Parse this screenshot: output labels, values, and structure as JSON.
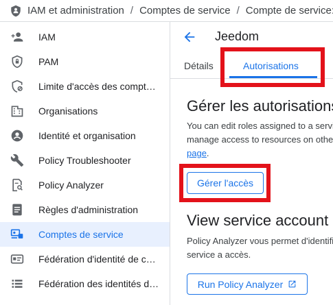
{
  "breadcrumb": {
    "items": [
      "IAM et administration",
      "Comptes de service",
      "Compte de service:"
    ],
    "separator": "/"
  },
  "sidebar": {
    "items": [
      {
        "label": "IAM",
        "icon": "person-add-icon"
      },
      {
        "label": "PAM",
        "icon": "shield-lock-icon"
      },
      {
        "label": "Limite d'accès des comptes principaux",
        "icon": "shield-boundary-icon"
      },
      {
        "label": "Organisations",
        "icon": "building-icon"
      },
      {
        "label": "Identité et organisation",
        "icon": "account-circle-icon"
      },
      {
        "label": "Policy Troubleshooter",
        "icon": "wrench-icon"
      },
      {
        "label": "Policy Analyzer",
        "icon": "document-search-icon"
      },
      {
        "label": "Règles d'administration",
        "icon": "document-list-icon"
      },
      {
        "label": "Comptes de service",
        "icon": "service-account-icon",
        "active": true
      },
      {
        "label": "Fédération d'identité de charge de travail",
        "icon": "id-card-icon"
      },
      {
        "label": "Fédération des identités de personnel",
        "icon": "list-icon"
      }
    ]
  },
  "main": {
    "title": "Jeedom",
    "tabs": {
      "details": "Détails",
      "auth": "Autorisations"
    },
    "manage": {
      "heading": "Gérer les autorisations",
      "line1": "You can edit roles assigned to a service account",
      "line2_prefix": "manage access to resources on other",
      "line3_link": "page",
      "line3_suffix": ".",
      "button": "Gérer l'accès"
    },
    "view": {
      "heading": "View service account access",
      "line1": "Policy Analyzer vous permet d'identifier",
      "line2": "service a accès.",
      "button": "Run Policy Analyzer"
    }
  },
  "colors": {
    "accent": "#1a73e8",
    "active_bg": "#e8f0fe",
    "highlight_border": "#e3121a",
    "icon": "#5f6368"
  }
}
